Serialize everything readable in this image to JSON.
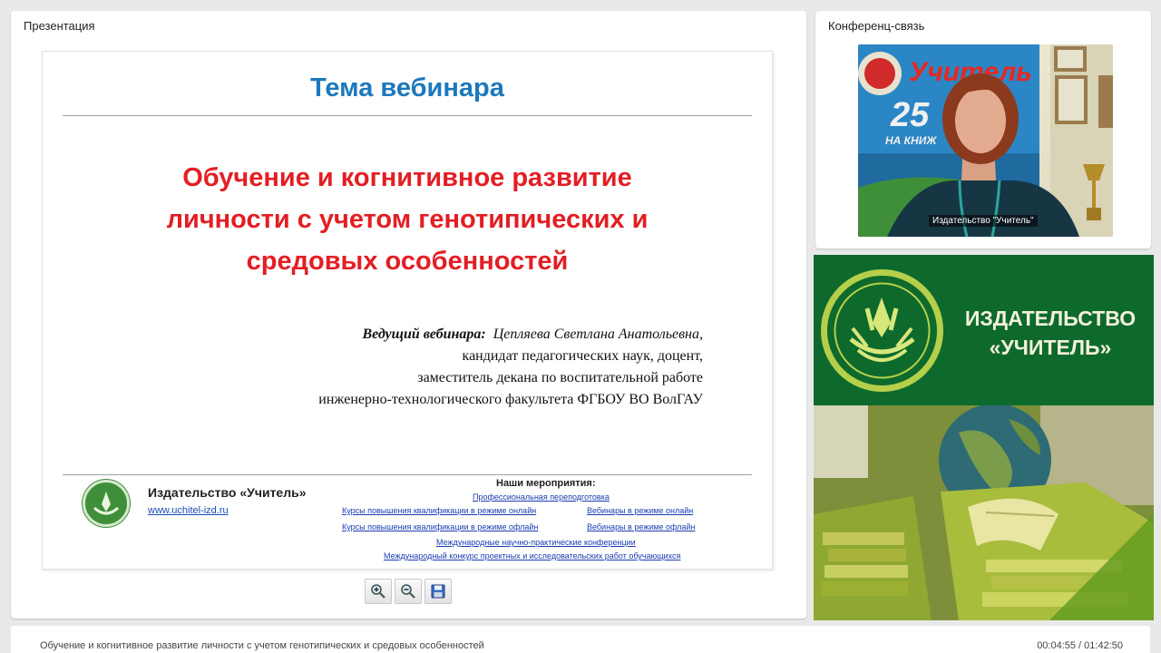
{
  "presentation": {
    "panel_title": "Презентация",
    "slide": {
      "heading": "Тема вебинара",
      "topic_lines": [
        "Обучение и когнитивное развитие",
        "личности с учетом генотипических и",
        "средовых особенностей"
      ],
      "presenter_label": "Ведущий вебинара",
      "presenter_name": "Цепляева Светлана Анатольевна,",
      "presenter_lines": [
        "кандидат педагогических наук,  доцент,",
        "заместитель декана по воспитательной работе",
        "инженерно-технологического факультета  ФГБОУ ВО ВолГАУ"
      ],
      "publisher_name": "Издательство «Учитель»",
      "publisher_url": "www.uchitel-izd.ru",
      "events_title": "Наши мероприятия:",
      "event_links": [
        "Профессиональная переподготовка",
        "Курсы повышения квалификации в режиме онлайн",
        "Вебинары в режиме онлайн",
        "Курсы повышения квалификации в режиме офлайн",
        "Вебинары в режиме офлайн",
        "Международные научно-практические конференции",
        "Международный конкурс проектных и исследовательских работ обучающихся"
      ]
    },
    "toolbar": {
      "icons": [
        "zoom-in-icon",
        "zoom-out-icon",
        "save-icon"
      ]
    }
  },
  "conference": {
    "panel_title": "Конференц-связь",
    "video_name_label": "Издательство \"Учитель\"",
    "banner_text": "Учитель",
    "banner_number": "25",
    "banner_sub": "НА КНИЖ"
  },
  "ad": {
    "title_line1": "ИЗДАТЕЛЬСТВО",
    "title_line2": "«УЧИТЕЛЬ»"
  },
  "footer": {
    "title": "Обучение и когнитивное развитие личности с учетом генотипических и средовых особенностей",
    "time": "00:04:55 / 01:42:50"
  },
  "colors": {
    "heading_blue": "#1c78bd",
    "topic_red": "#e31e24",
    "brand_green": "#0d6a2c"
  }
}
